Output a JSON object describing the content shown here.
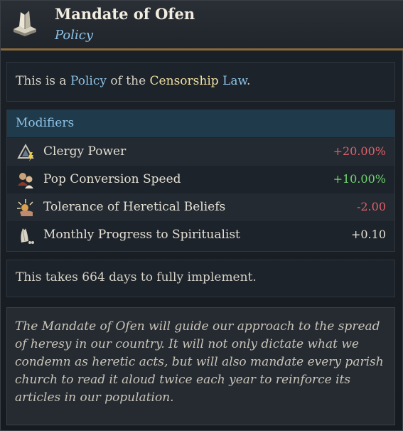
{
  "header": {
    "title": "Mandate of Ofen",
    "subtitle": "Policy",
    "icon": "book-icon"
  },
  "law": {
    "prefix": "This is a ",
    "policy_word": "Policy",
    "middle": " of the ",
    "law_name": "Censorship",
    "space": " ",
    "law_word": "Law",
    "suffix": "."
  },
  "modifiers": {
    "header": "Modifiers",
    "rows": [
      {
        "label": "Clergy Power",
        "value": "+20.00%",
        "icon": "clergy-power-icon",
        "tone": "negative"
      },
      {
        "label": "Pop Conversion Speed",
        "value": "+10.00%",
        "icon": "pop-conversion-icon",
        "tone": "positive"
      },
      {
        "label": "Tolerance of Heretical Beliefs",
        "value": "-2.00",
        "icon": "tolerance-icon",
        "tone": "negative"
      },
      {
        "label": "Monthly Progress to Spiritualist",
        "value": "+0.10",
        "icon": "spiritualist-icon",
        "tone": "neutral"
      }
    ]
  },
  "implement": {
    "text": "This takes 664 days to fully implement."
  },
  "description": {
    "text": "The Mandate of Ofen will guide our approach to the spread of heresy in our country. It will not only dictate what we condemn as heretic acts, but will also mandate every parish church to read it aloud twice each year to reinforce its articles in our population."
  },
  "colors": {
    "accent_blue": "#8ec2e6",
    "keyword_yellow": "#f0e0a0",
    "negative": "#e0606a",
    "positive": "#6ed66e",
    "header_border": "#8a6a3a"
  }
}
